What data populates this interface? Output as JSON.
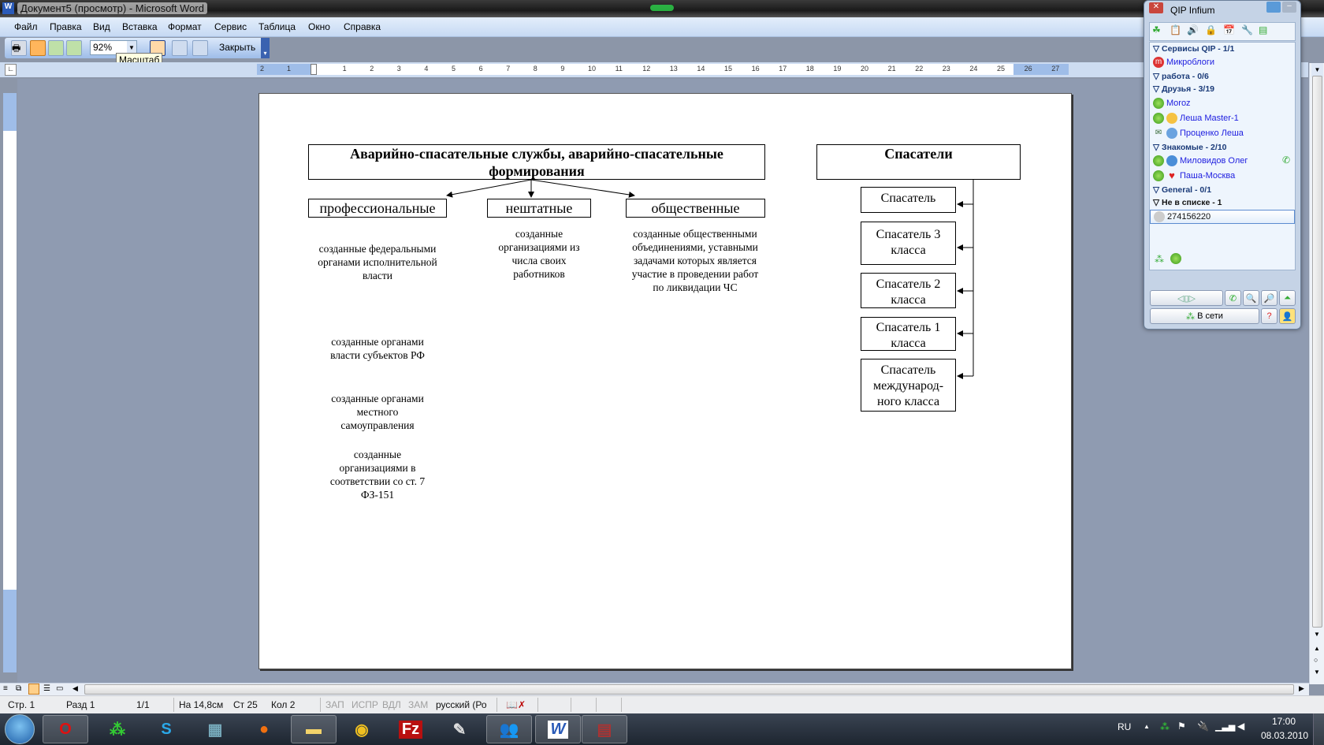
{
  "window": {
    "title": "Документ5 (просмотр) - Microsoft Word"
  },
  "menu": [
    "Файл",
    "Правка",
    "Вид",
    "Вставка",
    "Формат",
    "Сервис",
    "Таблица",
    "Окно",
    "Справка"
  ],
  "toolbar": {
    "zoom_value": "92%",
    "close_label": "Закрыть",
    "tooltip": "Масштаб"
  },
  "ruler": {
    "h_ticks": [
      "2",
      "1",
      "1",
      "2",
      "3",
      "4",
      "5",
      "6",
      "7",
      "8",
      "9",
      "10",
      "11",
      "12",
      "13",
      "14",
      "15",
      "16",
      "17",
      "18",
      "19",
      "20",
      "21",
      "22",
      "23",
      "24",
      "25",
      "26",
      "27"
    ]
  },
  "document": {
    "main_title": "Аварийно-спасательные службы, аварийно-спасательные формирования",
    "categories": [
      {
        "label": "профессиональные",
        "notes": [
          "созданные федеральными органами исполнительной власти",
          "созданные органами власти субъектов РФ",
          "созданные органами местного самоуправления",
          "созданные организациями в соответствии со ст. 7 ФЗ-151"
        ]
      },
      {
        "label": "нештатные",
        "notes": [
          "созданные организациями из числа своих работников"
        ]
      },
      {
        "label": "общественные",
        "notes": [
          "созданные общественными объединениями, уставными задачами которых является участие в проведении работ по ликвидации ЧС"
        ]
      }
    ],
    "rescuers_title": "Спасатели",
    "rescuer_levels": [
      "Спасатель",
      "Спасатель 3 класса",
      "Спасатель 2 класса",
      "Спасатель 1 класса",
      "Спасатель международ-ного класса"
    ]
  },
  "status": {
    "page": "Стр. 1",
    "section": "Разд 1",
    "pages": "1/1",
    "at": "На 14,8см",
    "line": "Ст 25",
    "col": "Кол 2",
    "rec": "ЗАП",
    "trk": "ИСПР",
    "ext": "ВДЛ",
    "ovr": "ЗАМ",
    "lang": "русский (Ро"
  },
  "qip": {
    "title": "QIP Infium",
    "groups": [
      {
        "name": "Сервисы QIP - 1/1",
        "contacts": [
          "Микроблоги"
        ]
      },
      {
        "name": "работа - 0/6",
        "contacts": []
      },
      {
        "name": "Друзья - 3/19",
        "contacts": [
          "Moroz",
          "Леша Master-1",
          "Проценко Леша"
        ]
      },
      {
        "name": "Знакомые - 2/10",
        "contacts": [
          "Миловидов Олег",
          "Паша-Москва"
        ]
      },
      {
        "name": "General - 0/1",
        "contacts": []
      },
      {
        "name": "Не в списке - 1",
        "contacts": [
          "274156220"
        ]
      }
    ],
    "status_label": "В сети",
    "help_label": "?"
  },
  "tray": {
    "lang": "RU",
    "time": "17:00",
    "date": "08.03.2010"
  }
}
